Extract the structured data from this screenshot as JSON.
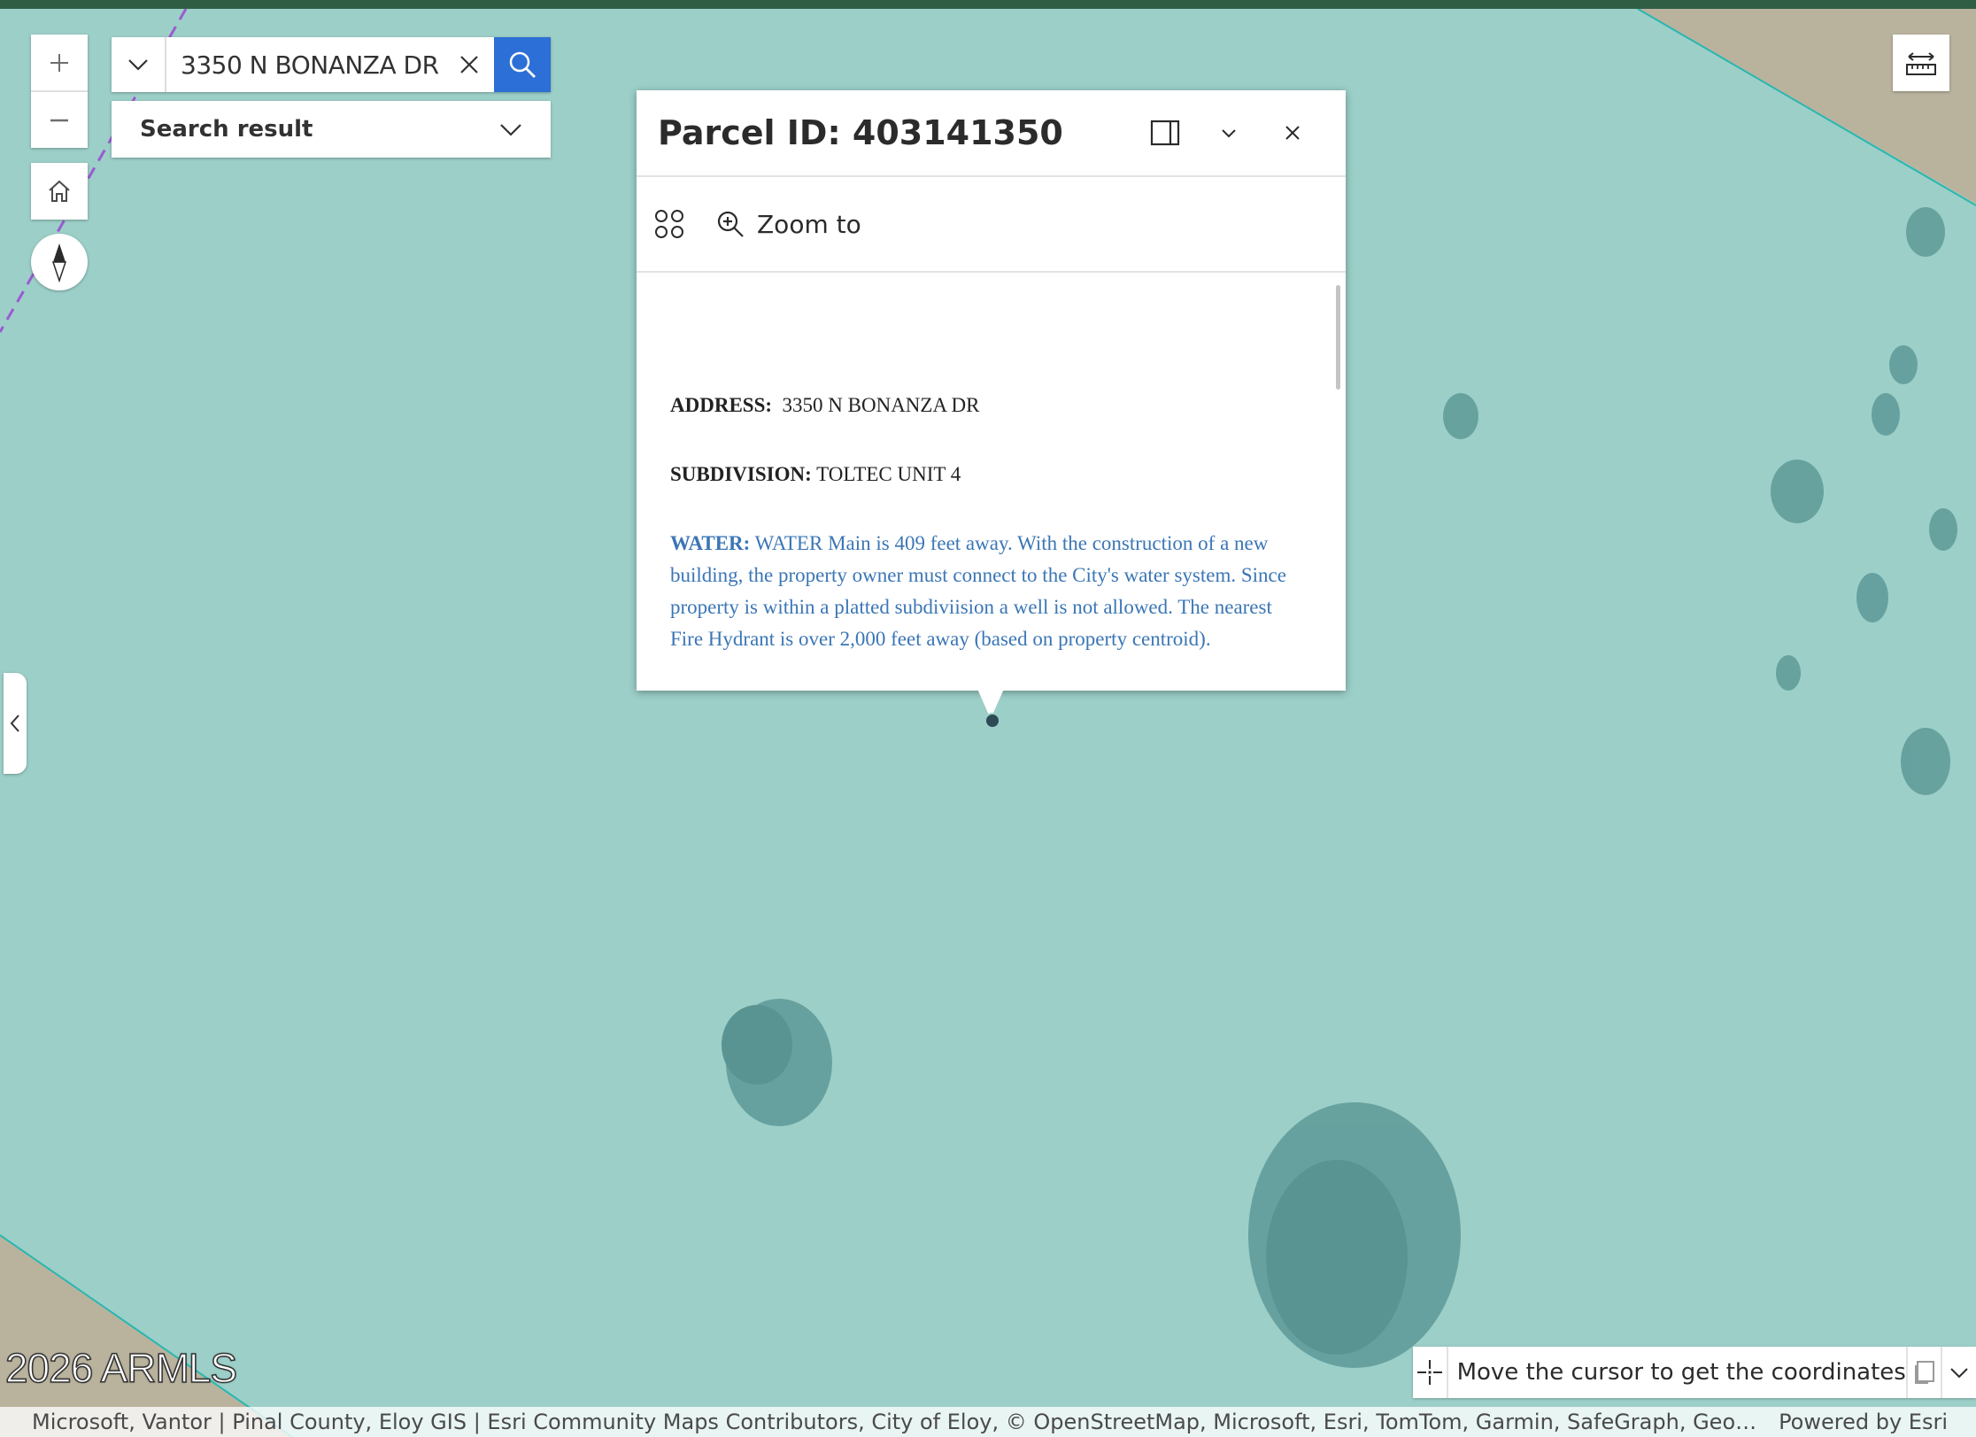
{
  "search": {
    "value": "3350 N BONANZA DR",
    "result_label": "Search result"
  },
  "popup": {
    "title": "Parcel ID: 403141350",
    "zoom_to": "Zoom to",
    "address_label": "ADDRESS:",
    "address_value": "3350 N BONANZA DR",
    "subdivision_label": "SUBDIVISION:",
    "subdivision_value": "TOLTEC UNIT 4",
    "water_label": "WATER:",
    "water_text": "WATER Main is 409 feet away. With the construction of a new building, the property owner must connect to the City's water system. Since property is within a platted subdiviision a well is not allowed. The nearest Fire Hydrant is over 2,000 feet away (based on property centroid)."
  },
  "coordinates": {
    "text": "Move the cursor to get the coordinates"
  },
  "watermark": "2026 ARMLS",
  "attribution": {
    "sources": "Microsoft, Vantor | Pinal County, Eloy GIS | Esri Community Maps Contributors, City of Eloy, © OpenStreetMap, Microsoft, Esri, TomTom, Garmin, SafeGraph, GeoTechnologies, Inc, M...",
    "powered_by": "Powered by Esri"
  },
  "colors": {
    "parcel_fill": "#9ccfc8",
    "ground": "#b9b39e",
    "search_button": "#2c6fd6",
    "water_text": "#3b76b5",
    "top_bar": "#2f5e45"
  },
  "icons": [
    "plus-icon",
    "minus-icon",
    "home-icon",
    "compass-icon",
    "chevron-down-icon",
    "clear-icon",
    "search-icon",
    "dock-icon",
    "close-icon",
    "features-icon",
    "zoom-in-icon",
    "measure-icon",
    "chevron-left-icon",
    "crosshair-icon",
    "copy-icon"
  ]
}
